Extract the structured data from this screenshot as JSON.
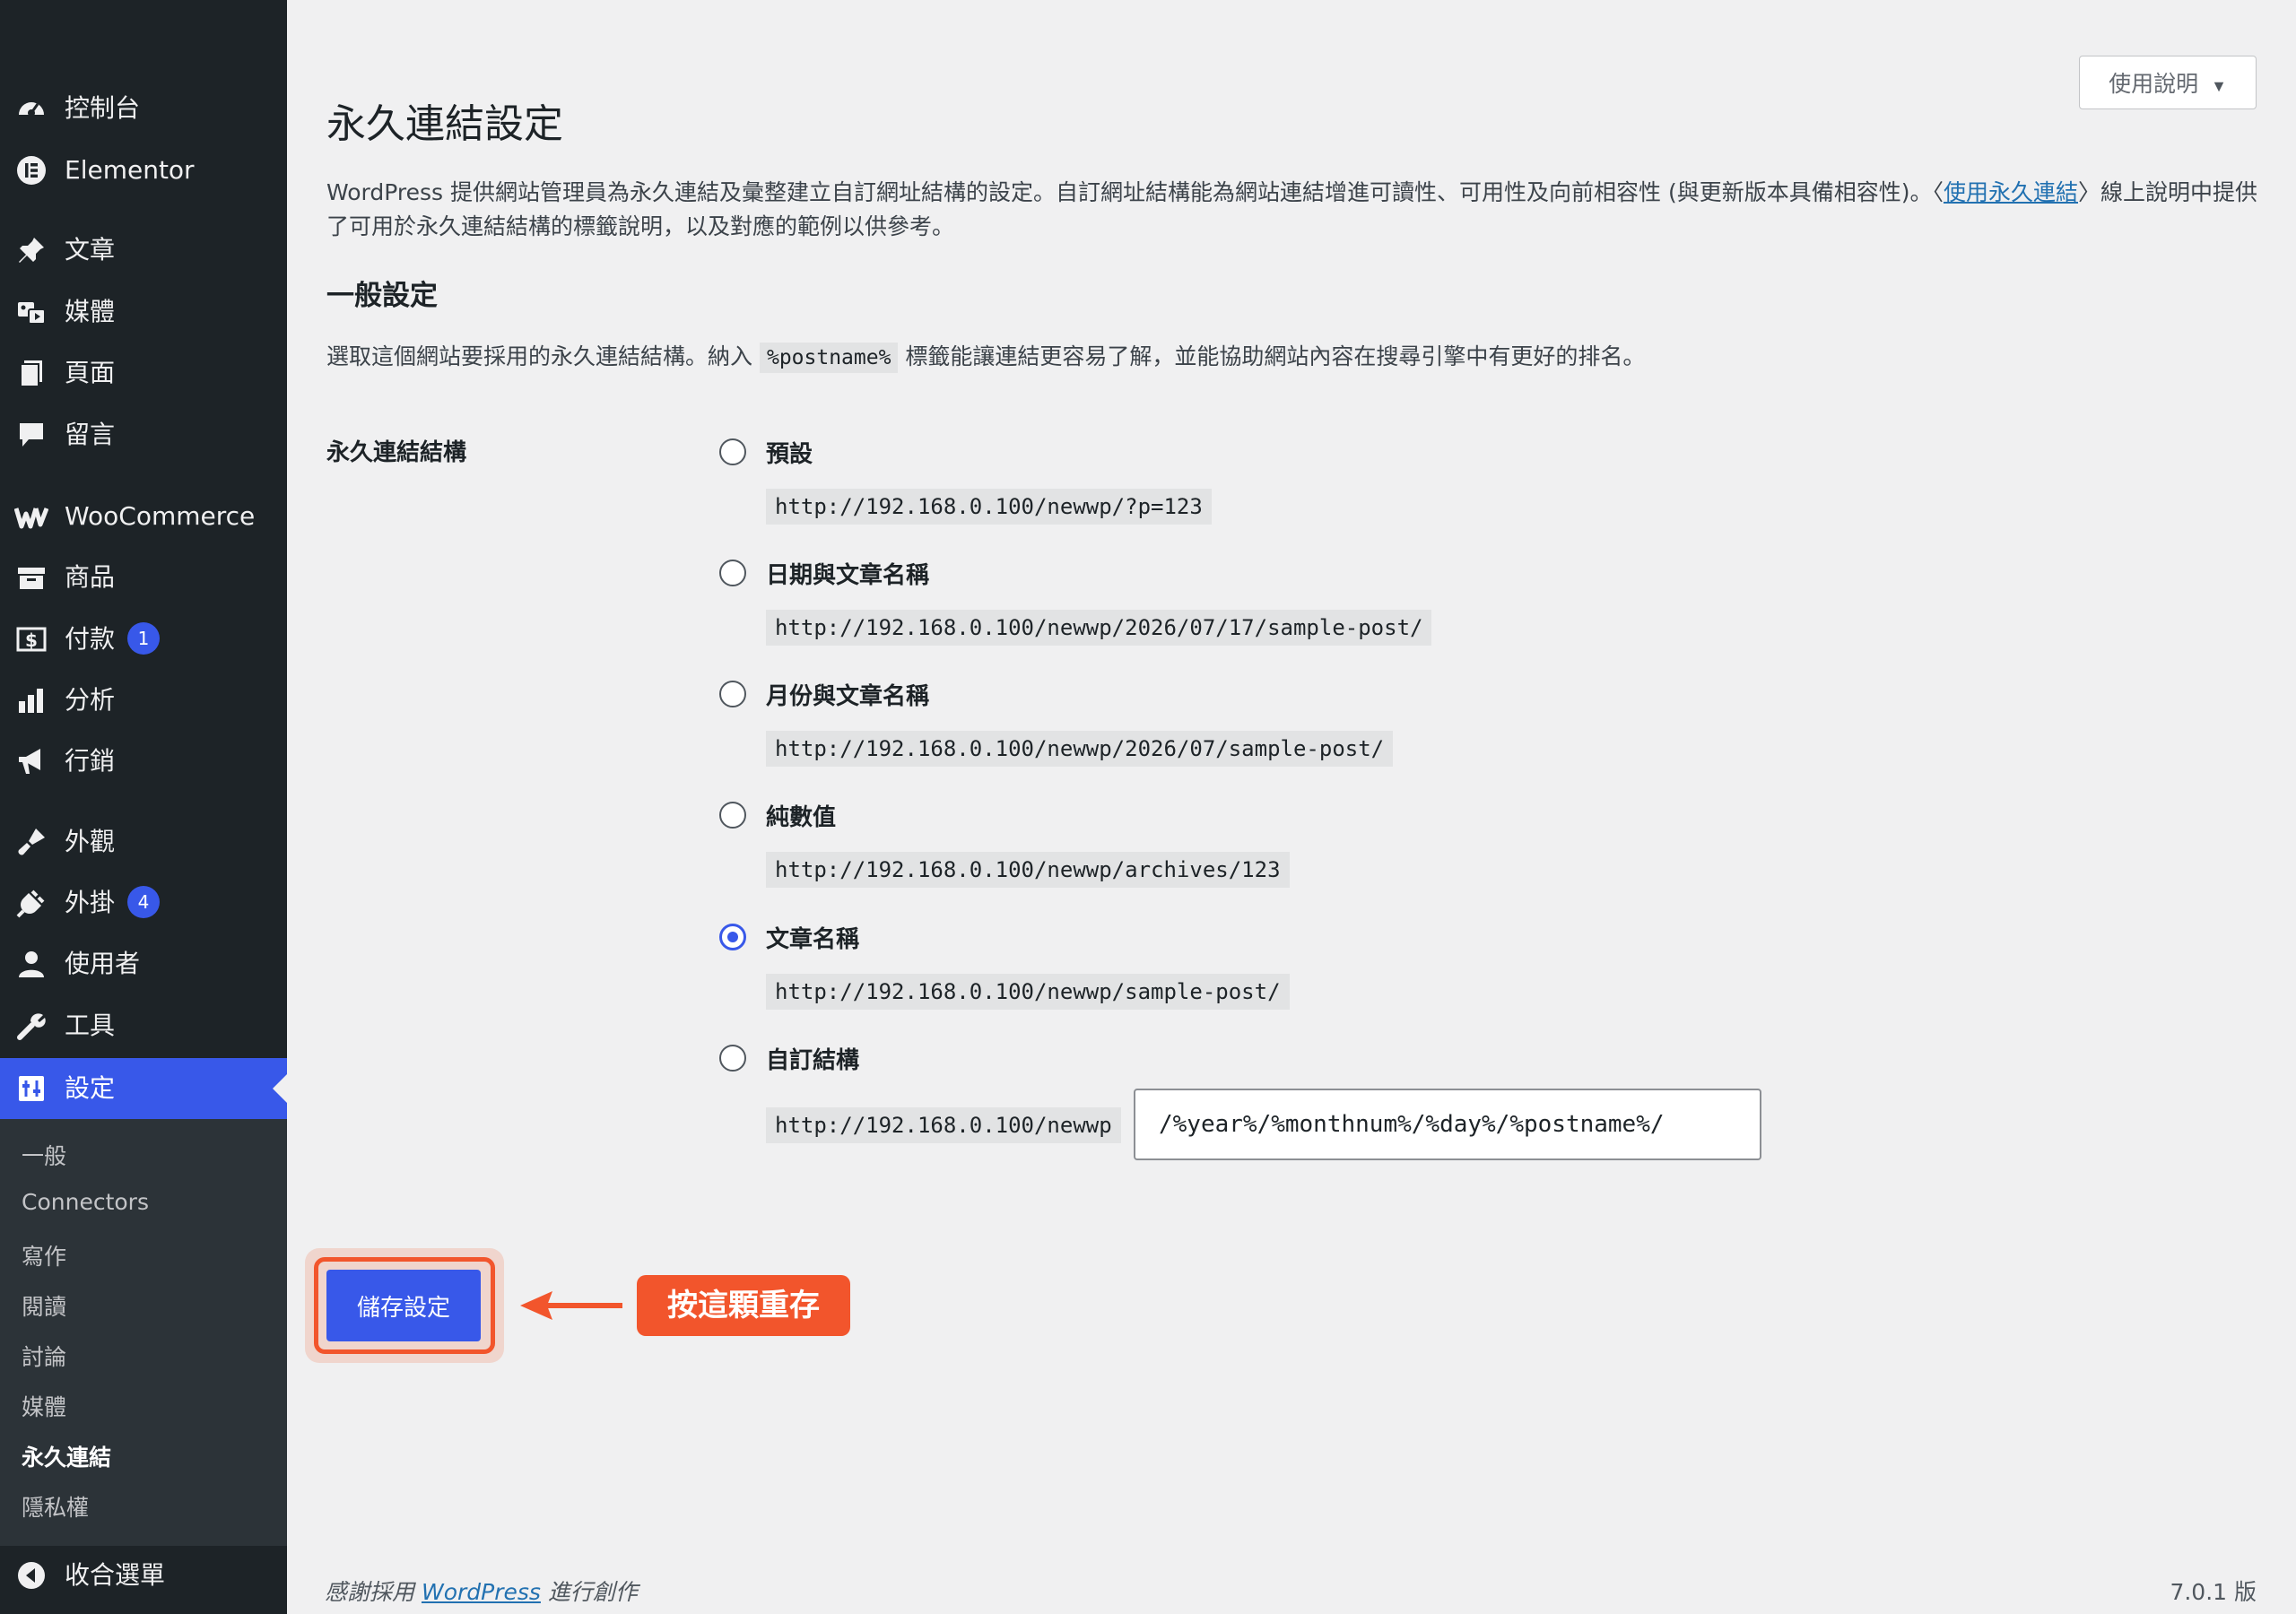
{
  "sidebar": {
    "menu": [
      {
        "label": "控制台",
        "icon": "dashboard-icon"
      },
      {
        "label": "Elementor",
        "icon": "elementor-icon"
      },
      {
        "label": "文章",
        "icon": "pin-icon"
      },
      {
        "label": "媒體",
        "icon": "media-icon"
      },
      {
        "label": "頁面",
        "icon": "pages-icon"
      },
      {
        "label": "留言",
        "icon": "comments-icon"
      },
      {
        "label": "WooCommerce",
        "icon": "woocommerce-icon"
      },
      {
        "label": "商品",
        "icon": "products-icon"
      },
      {
        "label": "付款",
        "icon": "payments-icon",
        "badge": "1"
      },
      {
        "label": "分析",
        "icon": "analytics-icon"
      },
      {
        "label": "行銷",
        "icon": "marketing-icon"
      },
      {
        "label": "外觀",
        "icon": "appearance-icon"
      },
      {
        "label": "外掛",
        "icon": "plugins-icon",
        "badge": "4"
      },
      {
        "label": "使用者",
        "icon": "users-icon"
      },
      {
        "label": "工具",
        "icon": "tools-icon"
      },
      {
        "label": "設定",
        "icon": "settings-icon",
        "active": true
      }
    ],
    "submenu": [
      "一般",
      "Connectors",
      "寫作",
      "閱讀",
      "討論",
      "媒體",
      "永久連結",
      "隱私權"
    ],
    "submenu_current": "永久連結",
    "collapse_label": "收合選單"
  },
  "help_tab": {
    "label": "使用說明",
    "caret": "▼"
  },
  "page": {
    "title": "永久連結設定",
    "intro_before": "WordPress 提供網站管理員為永久連結及彙整建立自訂網址結構的設定。自訂網址結構能為網站連結增進可讀性、可用性及向前相容性 (與更新版本具備相容性)。〈",
    "intro_link": "使用永久連結",
    "intro_after": "〉線上說明中提供了可用於永久連結結構的標籤說明，以及對應的範例以供參考。",
    "section_title": "一般設定",
    "section_desc_before": "選取這個網站要採用的永久連結結構。納入",
    "section_desc_code": "%postname%",
    "section_desc_after": "標籤能讓連結更容易了解，並能協助網站內容在搜尋引擎中有更好的排名。",
    "field_label": "永久連結結構"
  },
  "options": [
    {
      "label": "預設",
      "example": "http://192.168.0.100/newwp/?p=123",
      "checked": false
    },
    {
      "label": "日期與文章名稱",
      "example": "http://192.168.0.100/newwp/2026/07/17/sample-post/",
      "checked": false
    },
    {
      "label": "月份與文章名稱",
      "example": "http://192.168.0.100/newwp/2026/07/sample-post/",
      "checked": false
    },
    {
      "label": "純數值",
      "example": "http://192.168.0.100/newwp/archives/123",
      "checked": false
    },
    {
      "label": "文章名稱",
      "example": "http://192.168.0.100/newwp/sample-post/",
      "checked": true
    },
    {
      "label": "自訂結構",
      "example": "http://192.168.0.100/newwp",
      "checked": false
    }
  ],
  "custom_structure_value": "/%year%/%monthnum%/%day%/%postname%/",
  "save_button": "儲存設定",
  "callout": "按這顆重存",
  "footer": {
    "left_before": "感謝採用",
    "left_link": "WordPress",
    "left_after": "進行創作",
    "version": "7.0.1 版"
  },
  "colors": {
    "accent": "#3858e9",
    "callout": "#f2552c",
    "sidebar": "#1d2327"
  }
}
